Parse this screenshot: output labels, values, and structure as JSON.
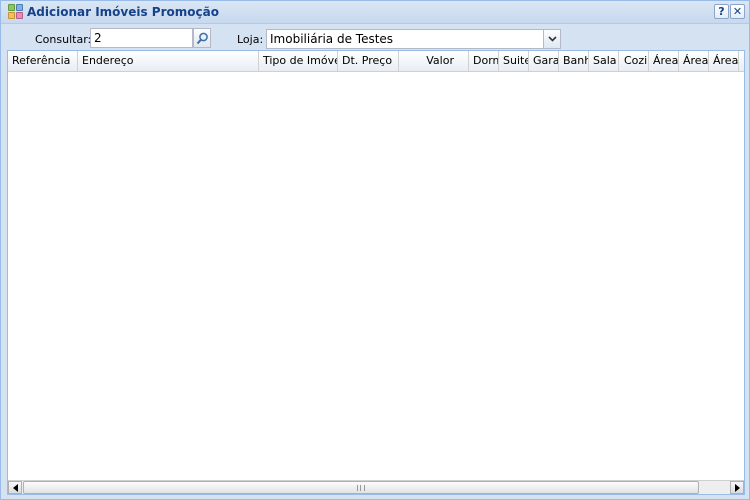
{
  "window": {
    "title": "Adicionar Imóveis Promoção",
    "title_icon": "grid-apps-icon",
    "help_label": "?",
    "close_label": "✕"
  },
  "form": {
    "consultar_label": "Consultar:",
    "consultar_value": "2",
    "search_icon": "search-icon",
    "loja_label": "Loja:",
    "loja_value": "Imobiliária de Testes"
  },
  "grid": {
    "columns": [
      "Referência",
      "Endereço",
      "Tipo de Imóvel",
      "Dt. Preço",
      "Valor",
      "Dorm",
      "Suite",
      "Gara",
      "Banh",
      "Sala",
      "Cozir",
      "Área",
      "Área",
      "Área"
    ],
    "rows": []
  },
  "colors": {
    "title_text": "#15428b",
    "window_bg": "#d5e2f2",
    "border": "#99bbe8"
  }
}
